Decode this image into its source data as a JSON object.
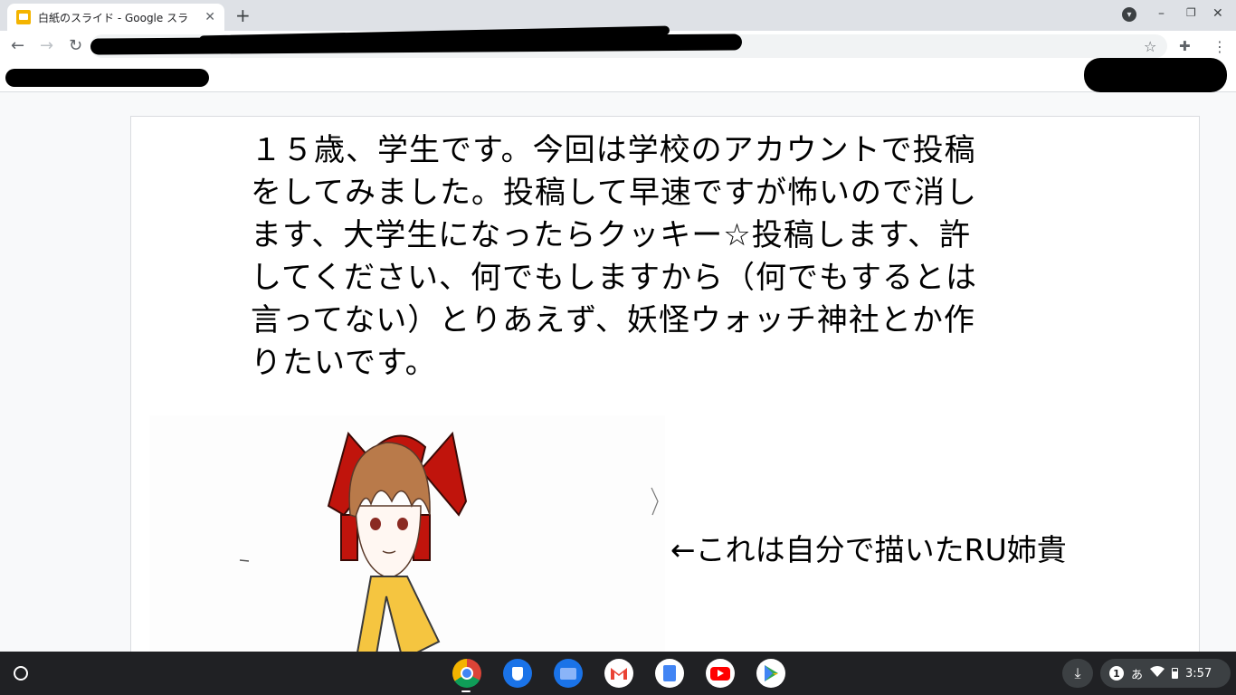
{
  "browser": {
    "tab": {
      "title": "白紙のスライド - Google スラ",
      "favicon": "slides-icon"
    },
    "close_glyph": "✕",
    "newtab_glyph": "+",
    "back_glyph": "←",
    "forward_glyph": "→",
    "reload_glyph": "↻",
    "star_glyph": "☆",
    "extensions_glyph": "✚",
    "menu_glyph": "⋮",
    "window_minimize": "–",
    "window_restore": "❐",
    "window_close": "✕",
    "profile_glyph": "▾"
  },
  "slide": {
    "text_lines": [
      "１５歳、学生です。今回は学校のアカウントで投稿",
      "をしてみました。投稿して早速ですが怖いので消し",
      "ます、大学生になったらクッキー☆投稿します、許",
      "してください、何でもしますから（何でもするとは",
      "言ってない）とりあえず、妖怪ウォッチ神社とか作",
      "りたいです。"
    ],
    "caption": "←これは自分で描いたRU姉貴"
  },
  "shelf": {
    "apps": [
      "chrome-icon",
      "security-icon",
      "files-icon",
      "gmail-icon",
      "docs-icon",
      "youtube-icon",
      "play-store-icon"
    ],
    "notification_count": "1",
    "ime": "あ",
    "time": "3:57"
  },
  "colors": {
    "accent": "#f4b400",
    "shelf": "#202124",
    "tabstrip": "#dee1e6"
  }
}
